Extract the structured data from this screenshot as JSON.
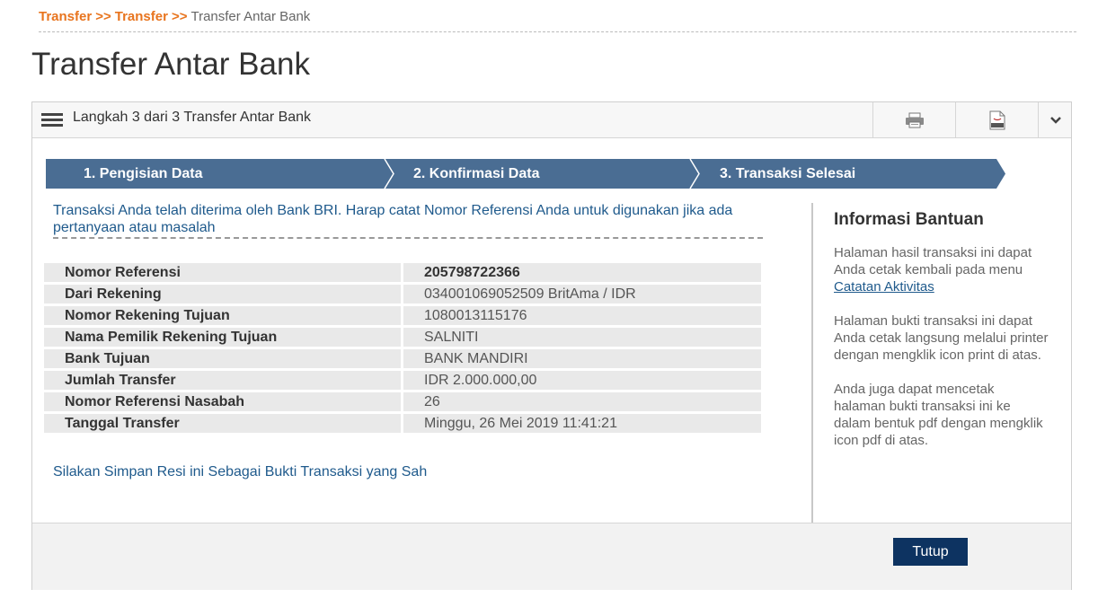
{
  "breadcrumb": {
    "items": [
      "Transfer",
      "Transfer"
    ],
    "separator": ">>",
    "current": "Transfer Antar Bank"
  },
  "page_title": "Transfer Antar Bank",
  "panel": {
    "title": "Langkah 3 dari 3 Transfer Antar Bank",
    "icons": [
      "menu-icon",
      "printer-icon",
      "pdf-icon",
      "chevron-down-icon"
    ]
  },
  "steps": [
    {
      "label": "1. Pengisian Data"
    },
    {
      "label": "2. Konfirmasi Data"
    },
    {
      "label": "3. Transaksi Selesai"
    }
  ],
  "message": "Transaksi Anda telah diterima oleh Bank BRI. Harap catat Nomor Referensi Anda untuk digunakan jika ada pertanyaan atau masalah",
  "details": [
    {
      "label": "Nomor Referensi",
      "value": "205798722366"
    },
    {
      "label": "Dari Rekening",
      "value": "034001069052509 BritAma / IDR"
    },
    {
      "label": "Nomor Rekening Tujuan",
      "value": "1080013115176"
    },
    {
      "label": "Nama Pemilik Rekening Tujuan",
      "value": "SALNITI"
    },
    {
      "label": "Bank Tujuan",
      "value": "BANK MANDIRI"
    },
    {
      "label": "Jumlah Transfer",
      "value": "IDR 2.000.000,00"
    },
    {
      "label": "Nomor Referensi Nasabah",
      "value": "26"
    },
    {
      "label": "Tanggal Transfer",
      "value": "Minggu, 26 Mei 2019 11:41:21"
    }
  ],
  "save_note": "Silakan Simpan Resi ini Sebagai Bukti Transaksi yang Sah",
  "help": {
    "title": "Informasi Bantuan",
    "para1": "Halaman hasil transaksi ini dapat Anda cetak kembali pada menu",
    "para1_link": "Catatan Aktivitas",
    "para2": "Halaman bukti transaksi ini dapat Anda cetak langsung melalui printer dengan mengklik icon print di atas.",
    "para3": "Anda juga dapat mencetak halaman bukti transaksi ini ke dalam bentuk pdf dengan mengklik icon pdf di atas."
  },
  "footer": {
    "close_label": "Tutup"
  },
  "colors": {
    "breadcrumb_link": "#e8741e",
    "step_bar": "#4a6d93",
    "link_text": "#1f5a8c",
    "close_button": "#0d3361"
  }
}
